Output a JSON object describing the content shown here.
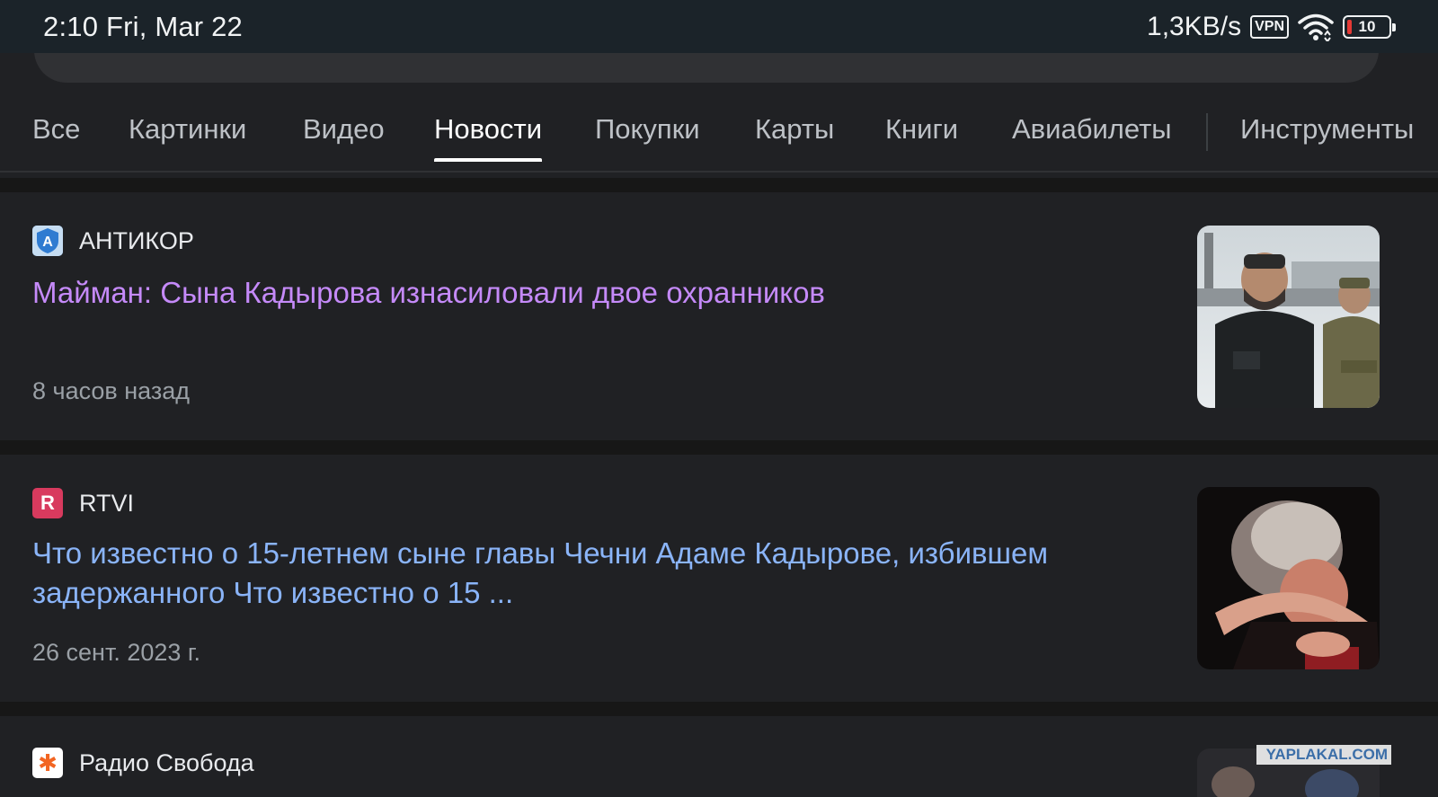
{
  "status_bar": {
    "time": "2:10 Fri, Mar 22",
    "net_speed": "1,3KB/s",
    "vpn": "VPN",
    "battery": "10"
  },
  "tabs": [
    {
      "label": "Все"
    },
    {
      "label": "Картинки"
    },
    {
      "label": "Видео"
    },
    {
      "label": "Новости",
      "active": true
    },
    {
      "label": "Покупки"
    },
    {
      "label": "Карты"
    },
    {
      "label": "Книги"
    },
    {
      "label": "Авиабилеты"
    },
    {
      "label": "Инструменты"
    }
  ],
  "results": [
    {
      "source": "АНТИКОР",
      "favicon_letter": "A",
      "headline": "Майман: Сына Кадырова изнасиловали двое охранников",
      "time": "8 часов назад",
      "visited": true
    },
    {
      "source": "RTVI",
      "favicon_letter": "R",
      "headline": "Что известно о 15-летнем сыне главы Чечни Адаме Кадырове, избившем задержанного Что известно о 15 ...",
      "time": "26 сент. 2023 г.",
      "visited": false
    },
    {
      "source": "Радио Свобода",
      "favicon_letter": "✱",
      "watermark": "YAPLAKAL.COM"
    }
  ],
  "colors": {
    "background": "#202124",
    "visited_link": "#c58af9",
    "link": "#8ab4f8",
    "statusbar": "#1b2329"
  }
}
